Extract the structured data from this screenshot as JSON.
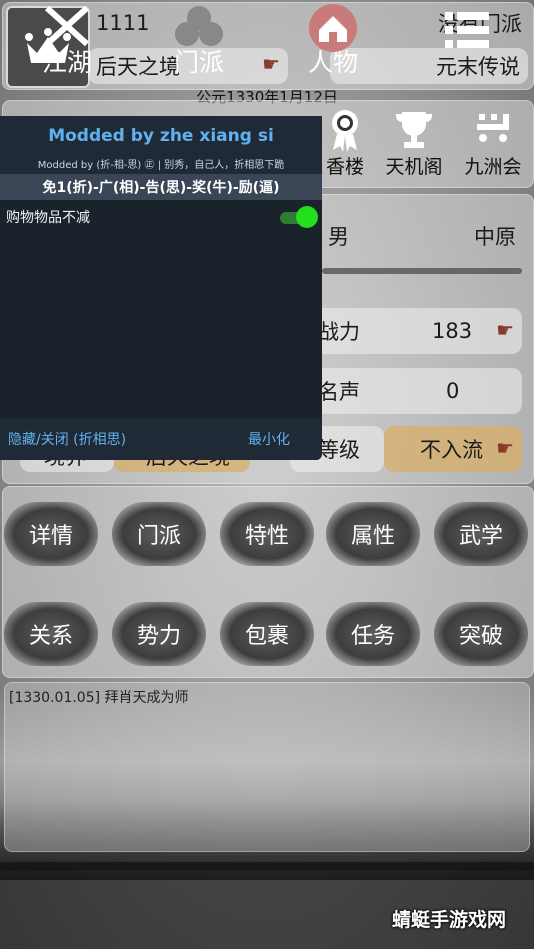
{
  "header": {
    "player_id": "1111",
    "sect": "没有门派",
    "realm": "后天之境",
    "era": "元末传说",
    "date": "公元1330年1月12日"
  },
  "top_nav": [
    {
      "label": "香楼",
      "icon": "award-icon"
    },
    {
      "label": "天机阁",
      "icon": "trophy-icon"
    },
    {
      "label": "九洲会",
      "icon": "cart-icon"
    }
  ],
  "profile": {
    "gender": "男",
    "region": "中原",
    "power_label": "战力",
    "power_value": "183",
    "fame_label": "名声",
    "fame_value": "0",
    "rank_label": "等级",
    "rank_value": "不入流",
    "hidden_left_label": "境界",
    "hidden_left_value": "后天之境"
  },
  "buttons": [
    "详情",
    "门派",
    "特性",
    "属性",
    "武学",
    "关系",
    "势力",
    "包裹",
    "任务",
    "突破"
  ],
  "log": {
    "entry": "[1330.01.05] 拜肖天成为师"
  },
  "bottom_nav": [
    "江湖",
    "门派",
    "人物",
    ""
  ],
  "mod_menu": {
    "title": "Modded by zhe xiang si",
    "subtitle": "Modded by (折-相-思) ㊣ | 别秀，自己人，折相思下跪",
    "banner": "免1(折)-广(相)-告(思)-奖(牛)-励(逼)",
    "option_label": "购物物品不减",
    "option_enabled": true,
    "hide_close": "隐藏/关闭 (折相思)",
    "minimize": "最小化"
  },
  "watermark": "蜻蜓手游戏网",
  "colors": {
    "accent": "#5fb2ee",
    "toggle_on": "#22e01e",
    "gold": "#d9af67"
  }
}
